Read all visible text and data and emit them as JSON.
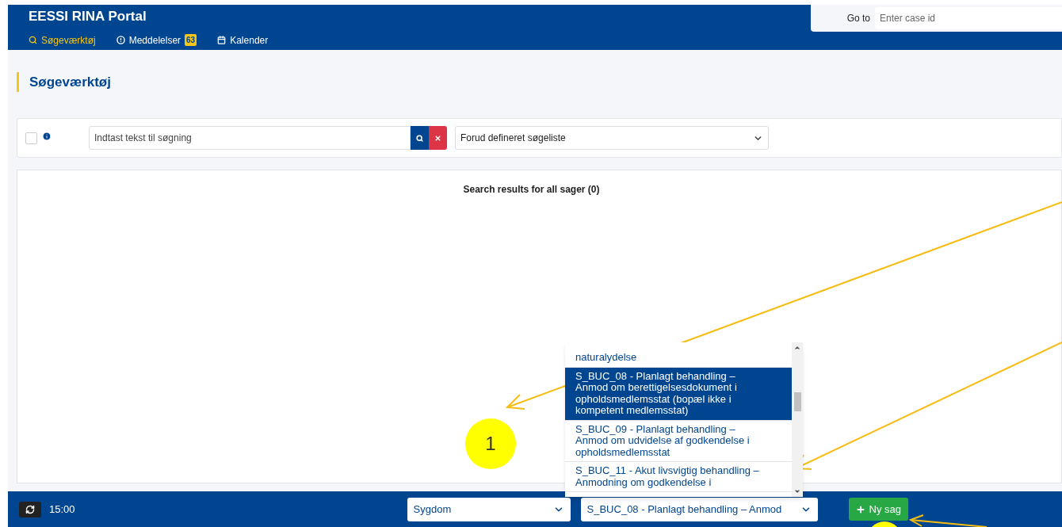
{
  "header": {
    "title": "EESSI RINA Portal",
    "goto": {
      "label": "Go to",
      "placeholder": "Enter case id"
    }
  },
  "nav": [
    {
      "label": "Søgeværktøj",
      "selected": true
    },
    {
      "label": "Meddelelser",
      "badge": "63",
      "selected": false
    },
    {
      "label": "Kalender",
      "selected": false
    }
  ],
  "page_title": "Søgeværktøj",
  "search": {
    "checked": false,
    "placeholder": "Indtast tekst til søgning",
    "list_select": "Forud defineret søgeliste"
  },
  "results": {
    "heading": "Search results for all sager (0)"
  },
  "dropdown_list": [
    {
      "text": "naturalydelse",
      "selected": false
    },
    {
      "text": "S_BUC_08 - Planlagt behandling – Anmod om berettigelsesdokument i opholdsmedlemsstat (bopæl ikke i kompetent medlemsstat)",
      "selected": true
    },
    {
      "text": "S_BUC_09 - Planlagt behandling – Anmod om udvidelse af godkendelse i opholdsmedlemsstat",
      "selected": false
    },
    {
      "text": "S_BUC_11 - Akut livsvigtig behandling – Anmodning om godkendelse i",
      "selected": false
    }
  ],
  "footer": {
    "time": "15:00",
    "sector": "Sygdom",
    "buc": "S_BUC_08 - Planlagt behandling – Anmod",
    "new_button": "Ny sag"
  },
  "annotation": {
    "marker": "1"
  }
}
